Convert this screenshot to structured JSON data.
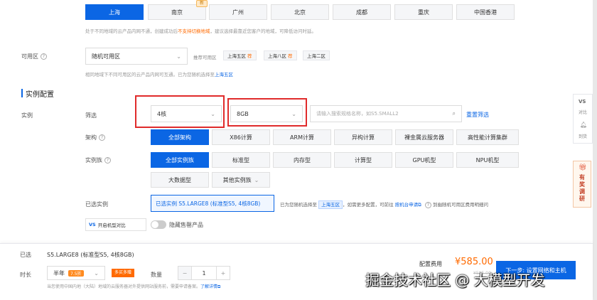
{
  "region": {
    "items": [
      "上海",
      "南京",
      "广州",
      "北京",
      "成都",
      "重庆",
      "中国香港"
    ],
    "selected": "上海",
    "new_badge": "新",
    "hint_prefix": "处于不同地域的云产品内网不通，创建成功后",
    "hint_red": "不支持切换地域",
    "hint_suffix": "，建议选择最靠近您客户的地域，可降低访问时延。"
  },
  "zone": {
    "label": "可用区",
    "value": "随机可用区",
    "recommend_label": "推荐可用区",
    "tags": [
      "上海五区",
      "上海八区",
      "上海二区"
    ],
    "hot_glyph": "荐",
    "hint_prefix": "相同地域下不同可用区的云产品内网可互通。已为您随机选择至",
    "hint_link": "上海五区"
  },
  "section_title": "实例配置",
  "instance": {
    "label": "实例",
    "filter_label": "筛选",
    "cpu_value": "4核",
    "mem_value": "8GB",
    "search_placeholder": "请输入搜索规格名称，如S5.SMALL2",
    "reset_link": "重置筛选",
    "arch_label": "架构",
    "arch": [
      "全部架构",
      "X86计算",
      "ARM计算",
      "异构计算",
      "裸金属云服务器",
      "高性能计算集群"
    ],
    "family_label": "实例族",
    "family_row1": [
      "全部实例族",
      "标准型",
      "内存型",
      "计算型",
      "GPU机型",
      "NPU机型"
    ],
    "family_row2_big": "大数据型",
    "family_row2_other": "其他实例族",
    "selected_label": "已选实例",
    "selected_value": "已选实例  S5.LARGE8 (标准型S5, 4核8GB)",
    "selected_hint_prefix": "已为您随机选择至",
    "selected_hint_zone": "上海五区",
    "selected_hint_mid": "，如需更多配置，可前往",
    "selected_hint_link": "按机台申请",
    "selected_hint_tail": "到幽随机可用区费用明细问",
    "compare_label": "开启机型对比",
    "hide_soldout_label": "隐藏售罄产品"
  },
  "side": {
    "vs_label": "VS",
    "compare_text": "对比",
    "notice_text": "到货",
    "gift_text": "有奖调研"
  },
  "footer": {
    "selected_label": "已选",
    "selected_value": "S5.LARGE8 (标准型S5, 4核8GB)",
    "duration_label": "时长",
    "duration_value": "半年",
    "duration_discount": "7.5折",
    "promo_badge": "多买多赠",
    "qty_label": "数量",
    "qty_minus": "−",
    "qty_value": "1",
    "qty_plus": "+",
    "hint_text": "当您使用中国内地（大陆）地域的云服务器对外提供网站服务前，需要申请备案。",
    "hint_link": "了解详情",
    "price_label": "配置费用",
    "price_value": "¥585.00",
    "price_sub": "¥585.00",
    "next_button": "下一步: 设置网络和主机"
  },
  "watermark": "掘金技术社区 @ 大模型开发"
}
